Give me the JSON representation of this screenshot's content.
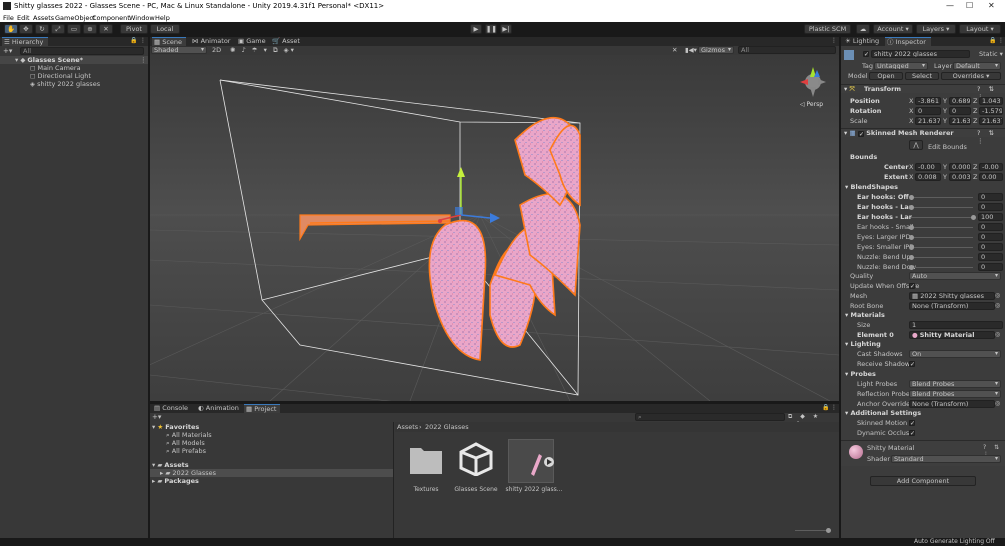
{
  "window": {
    "title": "Shitty glasses 2022 - Glasses Scene - PC, Mac & Linux Standalone - Unity 2019.4.31f1 Personal* <DX11>"
  },
  "menu": [
    "File",
    "Edit",
    "Assets",
    "GameObject",
    "Component",
    "Window",
    "Help"
  ],
  "toolbar": {
    "pivot": "Pivot",
    "local": "Local",
    "plastic_scm": "Plastic SCM",
    "account": "Account",
    "layers": "Layers",
    "layout": "Layout"
  },
  "hierarchy": {
    "tab": "Hierarchy",
    "search_placeholder": "All",
    "scene": "Glasses Scene*",
    "items": [
      "Main Camera",
      "Directional Light",
      "shitty 2022 glasses"
    ]
  },
  "scene_view": {
    "tabs": [
      "Scene",
      "Animator",
      "Game",
      "Asset Store"
    ],
    "shading": "Shaded",
    "mode_2d": "2D",
    "gizmos": "Gizmos",
    "search_placeholder": "All",
    "persp_label": "Persp"
  },
  "bottom": {
    "tabs": [
      "Console",
      "Animation",
      "Project"
    ],
    "favorites_label": "Favorites",
    "favorites": [
      "All Materials",
      "All Models",
      "All Prefabs"
    ],
    "assets_label": "Assets",
    "assets_children": [
      "2022 Glasses"
    ],
    "packages_label": "Packages",
    "breadcrumb_root": "Assets",
    "breadcrumb_leaf": "2022 Glasses",
    "files": [
      "Textures",
      "Glasses Scene",
      "shitty 2022 glass..."
    ],
    "status": "Auto Generate Lighting Off"
  },
  "inspector": {
    "tabs": [
      "Lighting",
      "Inspector"
    ],
    "object_name": "shitty 2022 glasses",
    "static_label": "Static",
    "tag_label": "Tag",
    "tag_value": "Untagged",
    "layer_label": "Layer",
    "layer_value": "Default",
    "model_label": "Model",
    "open_btn": "Open",
    "select_btn": "Select",
    "overrides_btn": "Overrides",
    "transform": {
      "title": "Transform",
      "position_label": "Position",
      "rotation_label": "Rotation",
      "scale_label": "Scale",
      "position": [
        "-3.861",
        "0.689",
        "1.043"
      ],
      "rotation": [
        "0",
        "0",
        "-1.579"
      ],
      "scale": [
        "21.637",
        "21.637",
        "21.637"
      ]
    },
    "skinned": {
      "title": "Skinned Mesh Renderer",
      "edit_bounds": "Edit Bounds",
      "bounds_label": "Bounds",
      "center_label": "Center",
      "extent_label": "Extent",
      "center": [
        "-0.00",
        "0.000",
        "-0.00"
      ],
      "extent": [
        "0.008",
        "0.003",
        "0.00"
      ],
      "blendshapes_label": "BlendShapes",
      "blendshapes": [
        {
          "name": "Ear hooks: Off ,",
          "value": "0",
          "level": 0.0,
          "bold": true
        },
        {
          "name": "Ear hooks - Lar",
          "value": "0",
          "level": 0.0,
          "bold": true
        },
        {
          "name": "Ear hooks - Lar",
          "value": "100",
          "level": 1.0,
          "bold": true
        },
        {
          "name": "Ear hooks - Small",
          "value": "0",
          "level": 0.0,
          "bold": false
        },
        {
          "name": "Eyes: Larger IPD",
          "value": "0",
          "level": 0.0,
          "bold": false
        },
        {
          "name": "Eyes: Smaller IPD",
          "value": "0",
          "level": 0.0,
          "bold": false
        },
        {
          "name": "Nuzzle: Bend Up",
          "value": "0",
          "level": 0.0,
          "bold": false
        },
        {
          "name": "Nuzzle: Bend Dow",
          "value": "0",
          "level": 0.0,
          "bold": false
        }
      ],
      "quality_label": "Quality",
      "quality_value": "Auto",
      "update_offscreen_label": "Update When Offscre",
      "mesh_label": "Mesh",
      "mesh_value": "2022 Shitty glasses",
      "root_bone_label": "Root Bone",
      "root_bone_value": "None (Transform)",
      "materials_label": "Materials",
      "size_label": "Size",
      "size_value": "1",
      "element0_label": "Element 0",
      "element0_value": "Shitty Material",
      "lighting_label": "Lighting",
      "cast_shadows_label": "Cast Shadows",
      "cast_shadows_value": "On",
      "receive_shadows_label": "Receive Shadows",
      "probes_label": "Probes",
      "light_probes_label": "Light Probes",
      "light_probes_value": "Blend Probes",
      "reflection_probes_label": "Reflection Probes",
      "reflection_probes_value": "Blend Probes",
      "anchor_override_label": "Anchor Override",
      "anchor_override_value": "None (Transform)",
      "additional_label": "Additional Settings",
      "skinned_motion_label": "Skinned Motion V",
      "dynamic_occlusion_label": "Dynamic Occlusic"
    },
    "material": {
      "name": "Shitty Material",
      "shader_label": "Shader",
      "shader_value": "Standard"
    },
    "add_component": "Add Component"
  },
  "colors": {
    "accent": "#3a79bb",
    "glasses_pink": "#e9a8c9",
    "outline_orange": "#ff7a1a"
  }
}
